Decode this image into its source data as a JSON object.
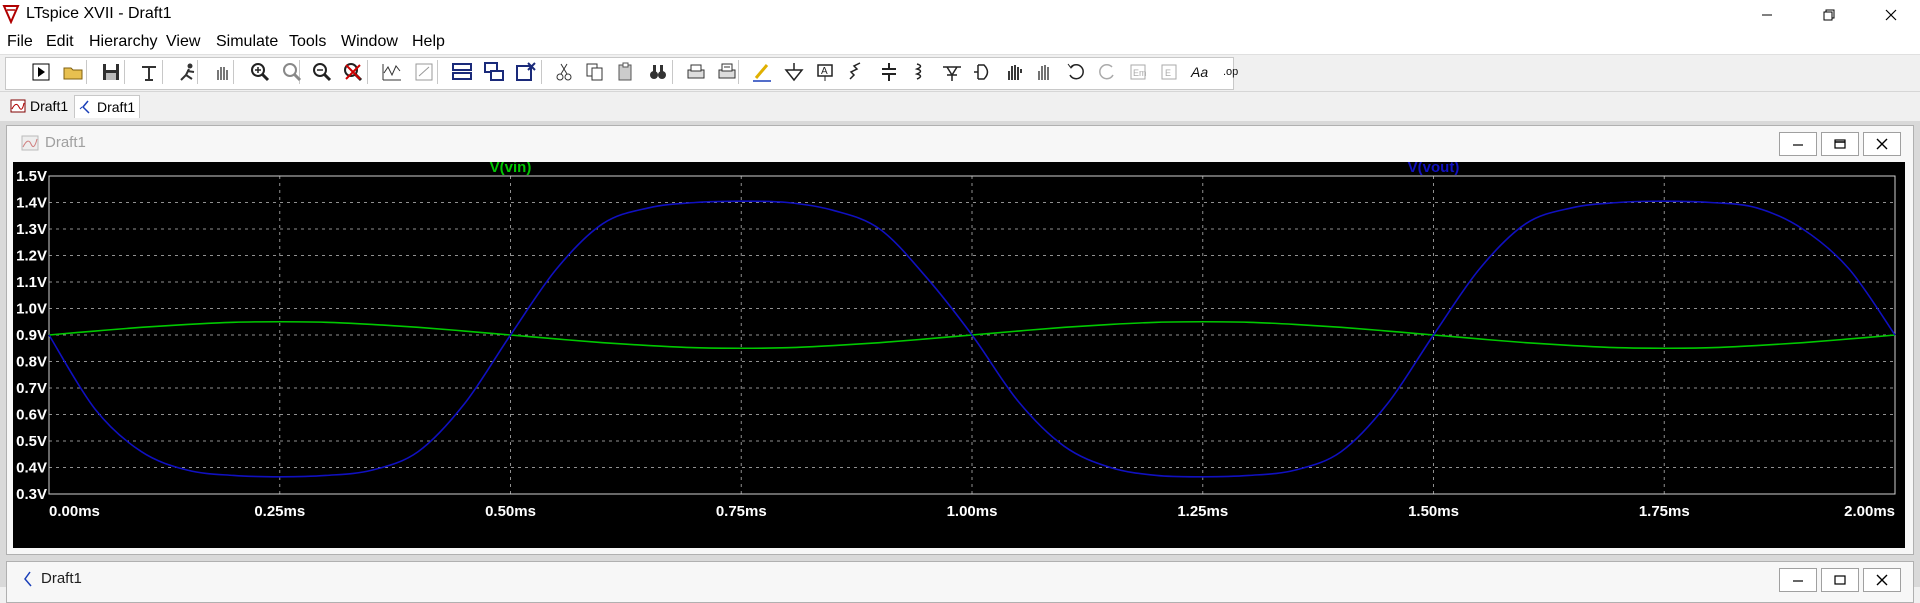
{
  "window": {
    "title": "LTspice XVII - Draft1"
  },
  "menu": [
    "File",
    "Edit",
    "Hierarchy",
    "View",
    "Simulate",
    "Tools",
    "Window",
    "Help"
  ],
  "toolbar_icons": [
    "run-icon",
    "open-icon",
    "save-icon",
    "control-panel-icon",
    "pick-visible-traces-icon",
    "pan-hand-icon",
    "zoom-in-icon",
    "zoom-area-icon",
    "zoom-out-icon",
    "zoom-fit-icon",
    "autorange-icon",
    "ruler-icon",
    "tile-windows-icon",
    "cascade-windows-icon",
    "close-windows-icon",
    "cut-icon",
    "copy-icon",
    "paste-icon",
    "find-icon",
    "print-icon",
    "print-setup-icon",
    "draw-wire-icon",
    "ground-icon",
    "label-net-icon",
    "resistor-icon",
    "capacitor-icon",
    "inductor-icon",
    "diode-icon",
    "component-icon",
    "move-icon",
    "drag-icon",
    "undo-icon",
    "redo-icon",
    "rotate-icon",
    "mirror-icon",
    "text-icon",
    "spice-directive-icon"
  ],
  "tabs": [
    {
      "label": "Draft1",
      "icon": "waveform-tab-icon"
    },
    {
      "label": "Draft1",
      "icon": "schematic-tab-icon"
    }
  ],
  "waveform_window": {
    "title": "Draft1"
  },
  "schematic_window": {
    "title": "Draft1"
  },
  "colors": {
    "vin": "#00c800",
    "vout": "#1010c0",
    "plot_bg": "#000000",
    "grid": "#909090",
    "label": "#ffffff"
  },
  "chart_data": {
    "type": "line",
    "x_unit": "ms",
    "y_unit": "V",
    "xlim": [
      0,
      2.0
    ],
    "ylim": [
      0.3,
      1.5
    ],
    "x_ticks": [
      "0.00ms",
      "0.25ms",
      "0.50ms",
      "0.75ms",
      "1.00ms",
      "1.25ms",
      "1.50ms",
      "1.75ms",
      "2.00ms"
    ],
    "y_ticks": [
      "1.5V",
      "1.4V",
      "1.3V",
      "1.2V",
      "1.1V",
      "1.0V",
      "0.9V",
      "0.8V",
      "0.7V",
      "0.6V",
      "0.5V",
      "0.4V",
      "0.3V"
    ],
    "grid": true,
    "series": [
      {
        "name": "V(vin)",
        "color": "#00c800",
        "x": [
          0,
          0.05,
          0.1,
          0.15,
          0.2,
          0.25,
          0.3,
          0.35,
          0.4,
          0.45,
          0.5,
          0.55,
          0.6,
          0.65,
          0.7,
          0.75,
          0.8,
          0.85,
          0.9,
          0.95,
          1.0,
          1.05,
          1.1,
          1.15,
          1.2,
          1.25,
          1.3,
          1.35,
          1.4,
          1.45,
          1.5,
          1.55,
          1.6,
          1.65,
          1.7,
          1.75,
          1.8,
          1.85,
          1.9,
          1.95,
          2.0
        ],
        "y": [
          0.9,
          0.915,
          0.929,
          0.94,
          0.948,
          0.95,
          0.948,
          0.94,
          0.929,
          0.915,
          0.9,
          0.885,
          0.871,
          0.86,
          0.852,
          0.85,
          0.852,
          0.86,
          0.871,
          0.885,
          0.9,
          0.915,
          0.929,
          0.94,
          0.948,
          0.95,
          0.948,
          0.94,
          0.929,
          0.915,
          0.9,
          0.885,
          0.871,
          0.86,
          0.852,
          0.85,
          0.852,
          0.86,
          0.871,
          0.885,
          0.9
        ]
      },
      {
        "name": "V(vout)",
        "color": "#1010c0",
        "x": [
          0,
          0.05,
          0.1,
          0.15,
          0.2,
          0.25,
          0.3,
          0.35,
          0.4,
          0.45,
          0.5,
          0.55,
          0.6,
          0.65,
          0.7,
          0.75,
          0.8,
          0.85,
          0.9,
          0.95,
          1.0,
          1.05,
          1.1,
          1.15,
          1.2,
          1.25,
          1.3,
          1.35,
          1.4,
          1.45,
          1.5,
          1.55,
          1.6,
          1.65,
          1.7,
          1.75,
          1.8,
          1.85,
          1.9,
          1.95,
          2.0
        ],
        "y": [
          0.9,
          0.62,
          0.46,
          0.39,
          0.37,
          0.365,
          0.37,
          0.39,
          0.46,
          0.64,
          0.9,
          1.15,
          1.32,
          1.38,
          1.4,
          1.405,
          1.4,
          1.37,
          1.3,
          1.12,
          0.9,
          0.65,
          0.48,
          0.4,
          0.37,
          0.365,
          0.37,
          0.39,
          0.46,
          0.64,
          0.9,
          1.15,
          1.32,
          1.38,
          1.4,
          1.405,
          1.4,
          1.38,
          1.3,
          1.15,
          0.9
        ]
      }
    ]
  }
}
